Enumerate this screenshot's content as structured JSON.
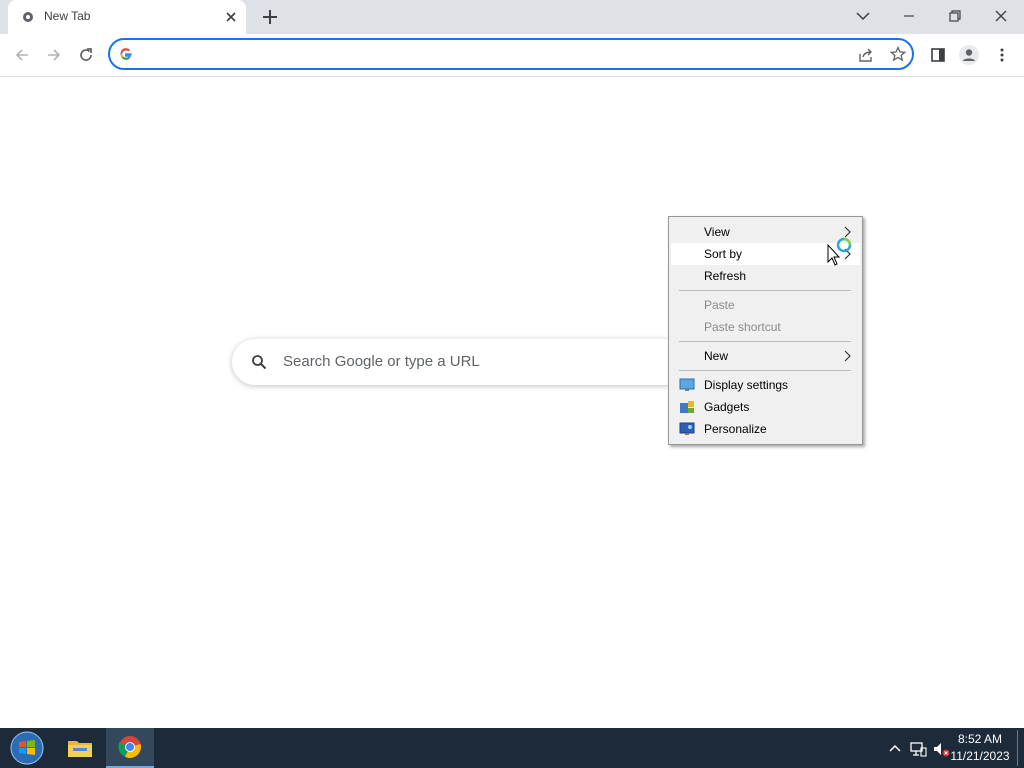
{
  "browser": {
    "tab_title": "New Tab",
    "omnibox_value": "",
    "ntp_search_placeholder": "Search Google or type a URL"
  },
  "context_menu": {
    "items": [
      {
        "label": "View",
        "has_submenu": true,
        "disabled": false
      },
      {
        "label": "Sort by",
        "has_submenu": true,
        "disabled": false,
        "hovered": true
      },
      {
        "label": "Refresh",
        "has_submenu": false,
        "disabled": false
      },
      {
        "label": "Paste",
        "has_submenu": false,
        "disabled": true
      },
      {
        "label": "Paste shortcut",
        "has_submenu": false,
        "disabled": true
      },
      {
        "label": "New",
        "has_submenu": true,
        "disabled": false
      },
      {
        "label": "Display settings",
        "icon": "display-settings-icon",
        "disabled": false
      },
      {
        "label": "Gadgets",
        "icon": "gadgets-icon",
        "disabled": false
      },
      {
        "label": "Personalize",
        "icon": "personalize-icon",
        "disabled": false
      }
    ]
  },
  "taskbar": {
    "time": "8:52 AM",
    "date": "11/21/2023",
    "apps": [
      "file-explorer-icon",
      "chrome-icon"
    ]
  },
  "colors": {
    "accent": "#1a73e8",
    "tabstrip": "#dee1e6",
    "taskbar": "#1c2a3a",
    "menu_bg": "#f0f0f0"
  }
}
